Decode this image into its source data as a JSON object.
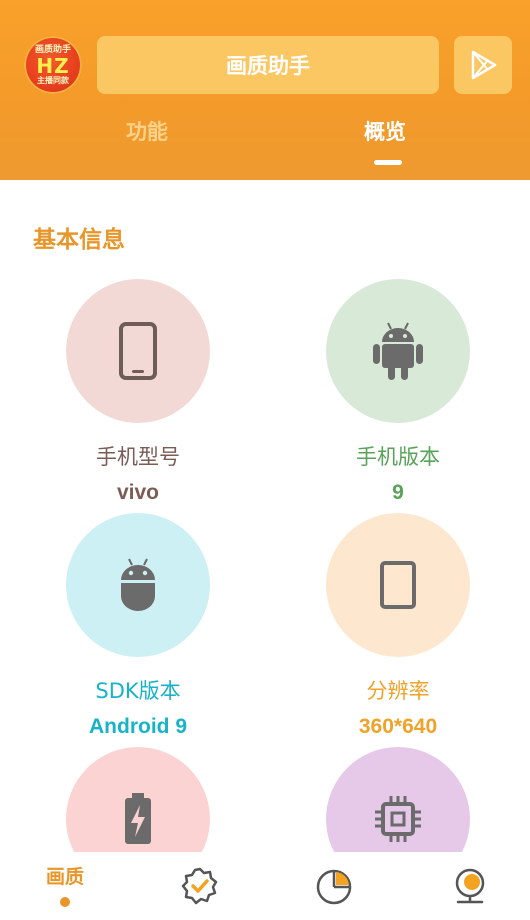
{
  "header": {
    "logo": {
      "line1": "画质助手",
      "line2": "HZ",
      "line3": "主播同款"
    },
    "title": "画质助手",
    "tabs": [
      {
        "label": "功能",
        "active": false
      },
      {
        "label": "概览",
        "active": true
      }
    ]
  },
  "section": {
    "title": "基本信息"
  },
  "info_items": [
    {
      "label": "手机型号",
      "value": "vivo",
      "icon": "phone-icon",
      "circle_color": "#f3d9d6",
      "icon_color": "#6e5d56",
      "text_color": "#7a5e55"
    },
    {
      "label": "手机版本",
      "value": "9",
      "icon": "android-icon",
      "circle_color": "#d8ead7",
      "icon_color": "#6b6b6b",
      "text_color": "#5aa25a"
    },
    {
      "label": "SDK版本",
      "value": "Android 9",
      "icon": "android-head-icon",
      "circle_color": "#cdf0f5",
      "icon_color": "#6b6b6b",
      "text_color": "#19b3c9"
    },
    {
      "label": "分辨率",
      "value": "360*640",
      "icon": "tablet-icon",
      "circle_color": "#fde8cf",
      "icon_color": "#6b6b6b",
      "text_color": "#f0a22a"
    },
    {
      "label": "",
      "value": "",
      "icon": "battery-charging-icon",
      "circle_color": "#fbd3d3",
      "icon_color": "#6b6b6b"
    },
    {
      "label": "",
      "value": "",
      "icon": "cpu-chip-icon",
      "circle_color": "#e6c8e9",
      "icon_color": "#6b6b6b"
    }
  ],
  "bottom_nav": {
    "items": [
      {
        "label": "画质",
        "icon": "quality-tab",
        "active": true
      },
      {
        "label": "",
        "icon": "verified-badge-icon",
        "active": false
      },
      {
        "label": "",
        "icon": "pie-chart-icon",
        "active": false
      },
      {
        "label": "",
        "icon": "webcam-icon",
        "active": false
      }
    ],
    "accent_color": "#e8962a"
  }
}
